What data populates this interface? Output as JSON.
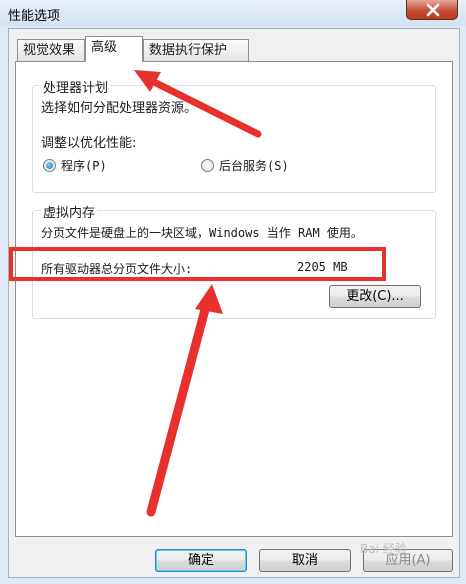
{
  "window": {
    "title": "性能选项"
  },
  "tabs": [
    {
      "label": "视觉效果",
      "active": false
    },
    {
      "label": "高级",
      "active": true
    },
    {
      "label": "数据执行保护",
      "active": false
    }
  ],
  "processor_group": {
    "label": "处理器计划",
    "description": "选择如何分配处理器资源。",
    "adjust_label": "调整以优化性能:",
    "options": [
      {
        "label": "程序(P)",
        "selected": true
      },
      {
        "label": "后台服务(S)",
        "selected": false
      }
    ]
  },
  "vm_group": {
    "label": "虚拟内存",
    "description": "分页文件是硬盘上的一块区域，Windows 当作 RAM 使用。",
    "total_label": "所有驱动器总分页文件大小:",
    "total_value": "2205 MB",
    "change_button": "更改(C)..."
  },
  "footer": {
    "ok": "确定",
    "cancel": "取消",
    "apply": "应用(A)"
  },
  "annotations": {
    "color": "#e8312c"
  },
  "watermark": "Bai 经验"
}
